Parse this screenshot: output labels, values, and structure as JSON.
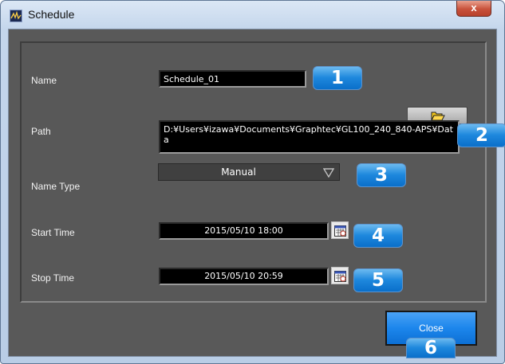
{
  "window": {
    "title": "Schedule",
    "close_glyph": "x"
  },
  "form": {
    "name_label": "Name",
    "name_value": "Schedule_01",
    "path_label": "Path",
    "path_value": "D:¥Users¥izawa¥Documents¥Graphtec¥GL100_240_840-APS¥Data",
    "name_type_label": "Name Type",
    "name_type_value": "Manual",
    "start_label": "Start Time",
    "start_value": "2015/05/10 18:00",
    "stop_label": "Stop Time",
    "stop_value": "2015/05/10 20:59"
  },
  "badges": [
    "1",
    "2",
    "3",
    "4",
    "5",
    "6"
  ],
  "footer": {
    "close_label": "Close"
  },
  "icons": [
    "app-icon",
    "folder-icon",
    "calendar-icon",
    "dropdown-arrow-icon"
  ],
  "colors": {
    "panel": "#595959",
    "field": "#000000",
    "accent": "#1c86ec",
    "badge": "#1e88dd"
  }
}
